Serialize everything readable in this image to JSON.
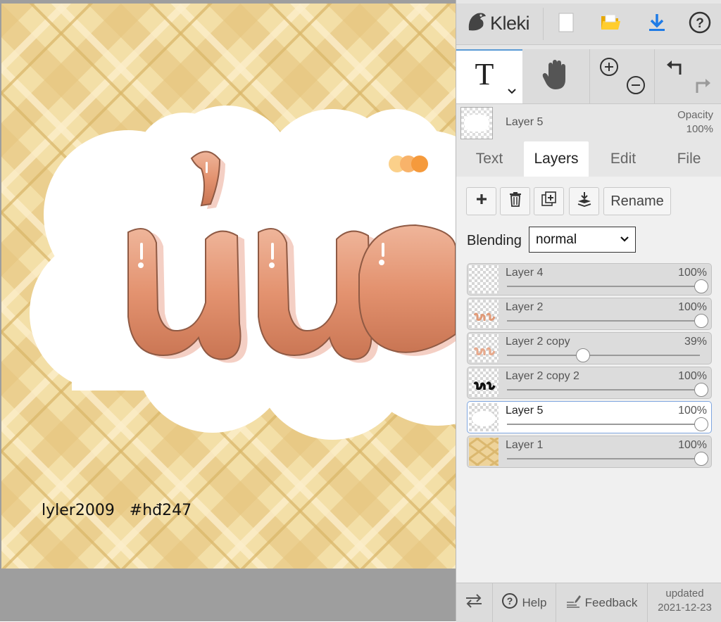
{
  "canvas": {
    "signature": "lyler2009   #hđ247",
    "colors": {
      "plaid_base": "#f3dfa7",
      "plaid_dark": "#d9b567",
      "cloud": "#ffffff",
      "letters": "#e09a78",
      "dots": [
        "#fbd08a",
        "#f8b36a",
        "#f59a3c"
      ]
    }
  },
  "topbar": {
    "logo": "Kleki",
    "icons": [
      "kleki-logo-icon",
      "new-file-icon",
      "open-folder-icon",
      "download-icon",
      "help-circle-icon"
    ]
  },
  "tools": {
    "text_tool_glyph": "T",
    "icons": [
      "text-tool-icon",
      "hand-tool-icon",
      "zoom-in-icon",
      "zoom-out-icon",
      "undo-icon",
      "redo-icon"
    ]
  },
  "current_layer": {
    "name": "Layer 5",
    "opacity_label": "Opacity",
    "opacity_value": "100%"
  },
  "tabs": [
    {
      "label": "Text",
      "active": false
    },
    {
      "label": "Layers",
      "active": true
    },
    {
      "label": "Edit",
      "active": false
    },
    {
      "label": "File",
      "active": false
    }
  ],
  "layers_panel": {
    "buttons": {
      "add_icon": "plus-icon",
      "delete_icon": "trash-icon",
      "duplicate_icon": "duplicate-icon",
      "merge_icon": "merge-down-icon",
      "rename": "Rename"
    },
    "blending_label": "Blending",
    "blending_value": "normal",
    "layers": [
      {
        "name": "Layer 4",
        "opacity": "100%",
        "level": 1.0,
        "selected": false
      },
      {
        "name": "Layer 2",
        "opacity": "100%",
        "level": 1.0,
        "selected": false
      },
      {
        "name": "Layer 2 copy",
        "opacity": "39%",
        "level": 0.39,
        "selected": false
      },
      {
        "name": "Layer 2 copy 2",
        "opacity": "100%",
        "level": 1.0,
        "selected": false
      },
      {
        "name": "Layer 5",
        "opacity": "100%",
        "level": 1.0,
        "selected": true
      },
      {
        "name": "Layer 1",
        "opacity": "100%",
        "level": 1.0,
        "selected": false
      }
    ]
  },
  "footer": {
    "help": "Help",
    "feedback": "Feedback",
    "updated_label": "updated",
    "updated_date": "2021-12-23"
  }
}
